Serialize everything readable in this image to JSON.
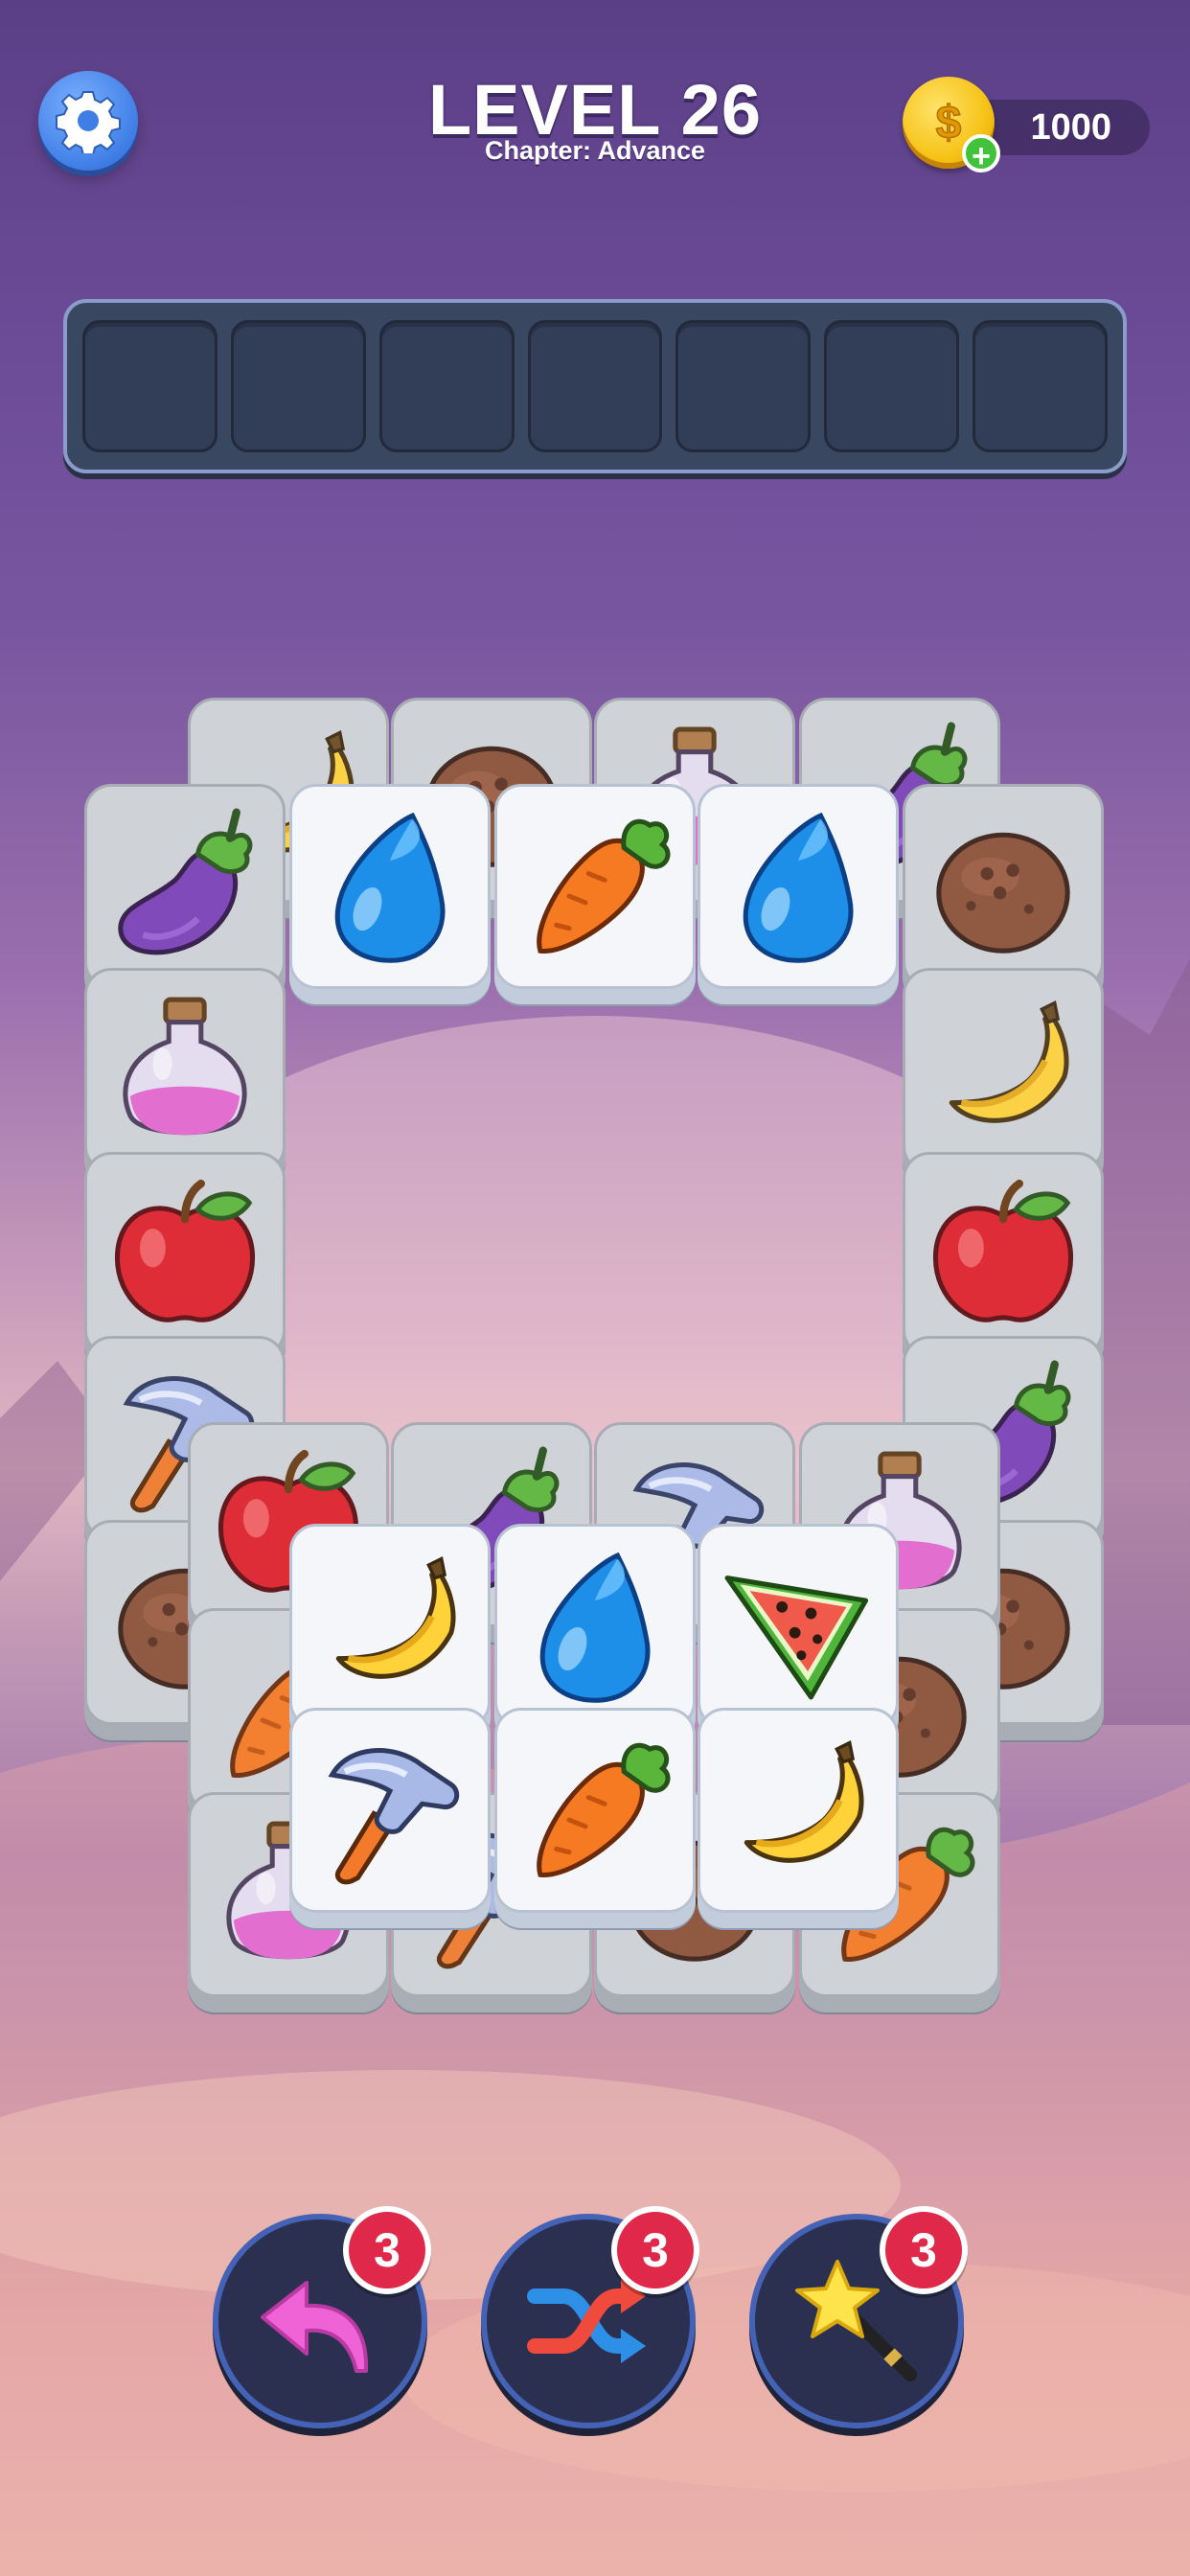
{
  "header": {
    "level_title": "LEVEL 26",
    "chapter": "Chapter: Advance",
    "coins": "1000",
    "settings_icon": "gear-icon",
    "coin_icon": "dollar-coin-icon",
    "add_coins_icon": "plus-icon"
  },
  "tray": {
    "slots": [
      "",
      "",
      "",
      "",
      "",
      "",
      ""
    ]
  },
  "tiles": [
    {
      "item": "banana",
      "state": "blocked"
    },
    {
      "item": "coconut",
      "state": "blocked"
    },
    {
      "item": "potion",
      "state": "blocked"
    },
    {
      "item": "eggplant",
      "state": "blocked"
    },
    {
      "item": "eggplant",
      "state": "blocked"
    },
    {
      "item": "coconut",
      "state": "blocked"
    },
    {
      "item": "water-drop",
      "state": "free"
    },
    {
      "item": "carrot",
      "state": "free"
    },
    {
      "item": "water-drop",
      "state": "free"
    },
    {
      "item": "potion",
      "state": "blocked"
    },
    {
      "item": "banana",
      "state": "blocked"
    },
    {
      "item": "apple",
      "state": "blocked"
    },
    {
      "item": "apple",
      "state": "blocked"
    },
    {
      "item": "hammer",
      "state": "blocked"
    },
    {
      "item": "eggplant",
      "state": "blocked"
    },
    {
      "item": "coconut",
      "state": "blocked"
    },
    {
      "item": "coconut",
      "state": "blocked"
    },
    {
      "item": "apple",
      "state": "blocked"
    },
    {
      "item": "eggplant",
      "state": "blocked"
    },
    {
      "item": "hammer",
      "state": "blocked"
    },
    {
      "item": "potion",
      "state": "blocked"
    },
    {
      "item": "carrot",
      "state": "blocked"
    },
    {
      "item": "coconut",
      "state": "blocked"
    },
    {
      "item": "potion",
      "state": "blocked"
    },
    {
      "item": "hammer",
      "state": "blocked"
    },
    {
      "item": "coconut",
      "state": "blocked"
    },
    {
      "item": "carrot",
      "state": "blocked"
    },
    {
      "item": "banana",
      "state": "free"
    },
    {
      "item": "water-drop",
      "state": "free"
    },
    {
      "item": "watermelon",
      "state": "free"
    },
    {
      "item": "hammer",
      "state": "free"
    },
    {
      "item": "carrot",
      "state": "free"
    },
    {
      "item": "banana",
      "state": "free"
    }
  ],
  "boosters": [
    {
      "name": "undo",
      "icon": "undo-arrow-icon",
      "count": "3"
    },
    {
      "name": "shuffle",
      "icon": "shuffle-icon",
      "count": "3"
    },
    {
      "name": "magic-wand",
      "icon": "magic-wand-icon",
      "count": "3"
    }
  ]
}
